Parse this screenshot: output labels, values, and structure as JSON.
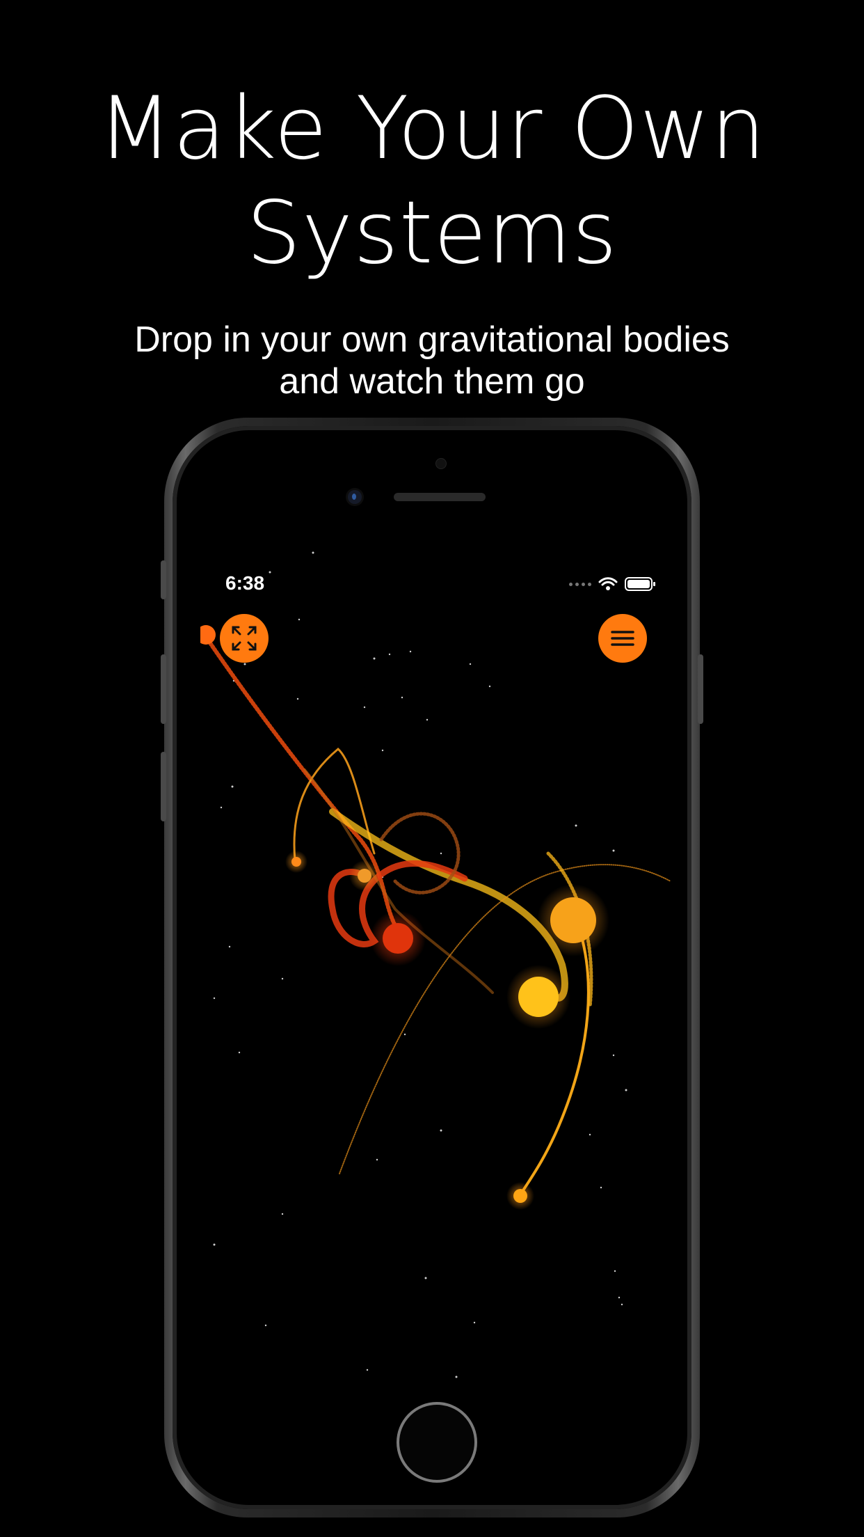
{
  "promo": {
    "headline_line1": "Make Your Own",
    "headline_line2": "Systems",
    "subhead_line1": "Drop in your own gravitational bodies",
    "subhead_line2": "and watch them go"
  },
  "status_bar": {
    "time": "6:38",
    "icons": [
      "signal-icon",
      "wifi-icon",
      "battery-icon"
    ]
  },
  "toolbar": {
    "left_button_icon": "expand-icon",
    "right_button_icon": "menu-icon"
  },
  "colors": {
    "accent": "#ff7a0f",
    "body_orange": "#f7a21a",
    "body_red": "#e0340c",
    "body_yellow": "#ffc21a",
    "background": "#000000"
  }
}
